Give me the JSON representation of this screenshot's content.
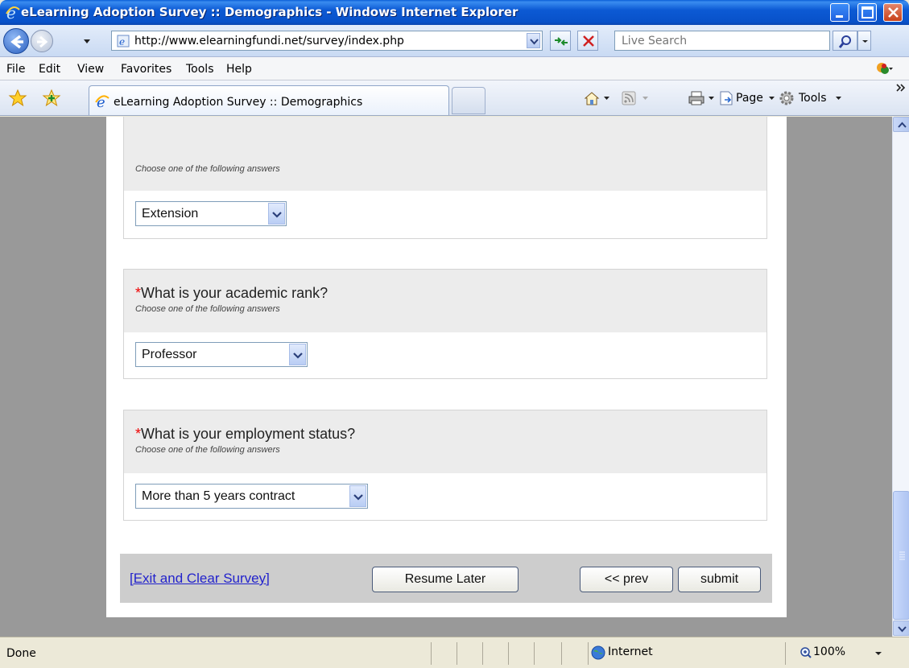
{
  "window": {
    "title": "eLearning Adoption Survey :: Demographics - Windows Internet Explorer"
  },
  "address": {
    "url": "http://www.elearningfundi.net/survey/index.php",
    "search_placeholder": "Live Search"
  },
  "menu": {
    "items": [
      "File",
      "Edit",
      "View",
      "Favorites",
      "Tools",
      "Help"
    ]
  },
  "tabs": {
    "current": "eLearning Adoption Survey :: Demographics"
  },
  "commandbar": {
    "page_label": "Page",
    "tools_label": "Tools"
  },
  "survey": {
    "partial_question": {
      "hint": "Choose one of the following answers",
      "selected": "Extension"
    },
    "questions": [
      {
        "required_mark": "*",
        "text": "What is your academic rank?",
        "hint": "Choose one of the following answers",
        "selected": "Professor"
      },
      {
        "required_mark": "*",
        "text": "What is your employment status?",
        "hint": "Choose one of the following answers",
        "selected": "More than 5 years contract"
      }
    ],
    "nav": {
      "exit_link": "[Exit and Clear Survey]",
      "resume_label": "Resume Later",
      "prev_label": "<< prev",
      "submit_label": "submit"
    }
  },
  "status": {
    "text": "Done",
    "zone": "Internet",
    "zoom": "100%"
  },
  "colors": {
    "titlebar": "#0c5ad4",
    "viewport_bg": "#999999",
    "question_header": "#ececec",
    "required_mark": "#ee0000",
    "link": "#2222cc"
  }
}
